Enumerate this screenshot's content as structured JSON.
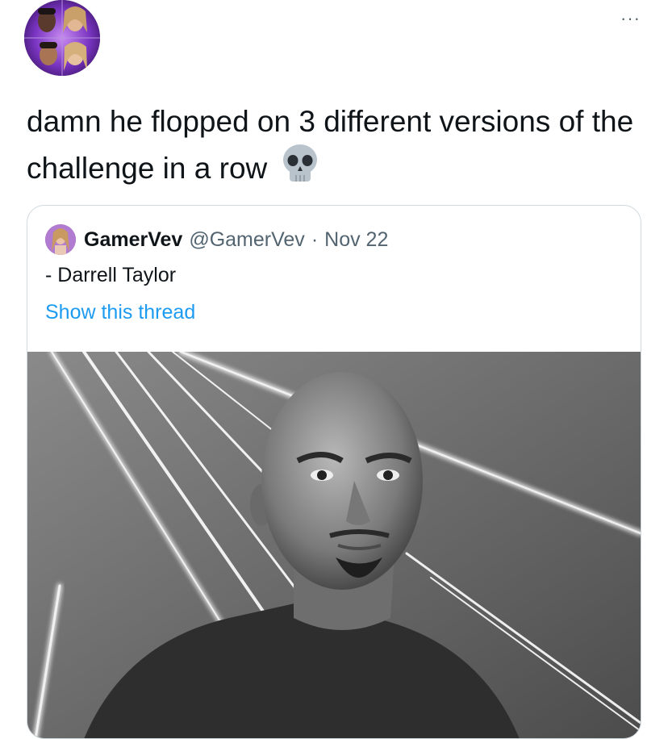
{
  "tweet": {
    "text": "damn he flopped on 3 different versions of the challenge in a row",
    "emoji_icon": "skull-icon",
    "more_label": "···"
  },
  "quoted": {
    "display_name": "GamerVev",
    "handle": "@GamerVev",
    "separator": "·",
    "date": "Nov 22",
    "body": "- Darrell Taylor",
    "thread_link": "Show this thread"
  },
  "colors": {
    "link": "#1d9bf0",
    "secondary_text": "#536471",
    "border": "#cfd9de",
    "avatar_purple": "#7c3fb0"
  }
}
